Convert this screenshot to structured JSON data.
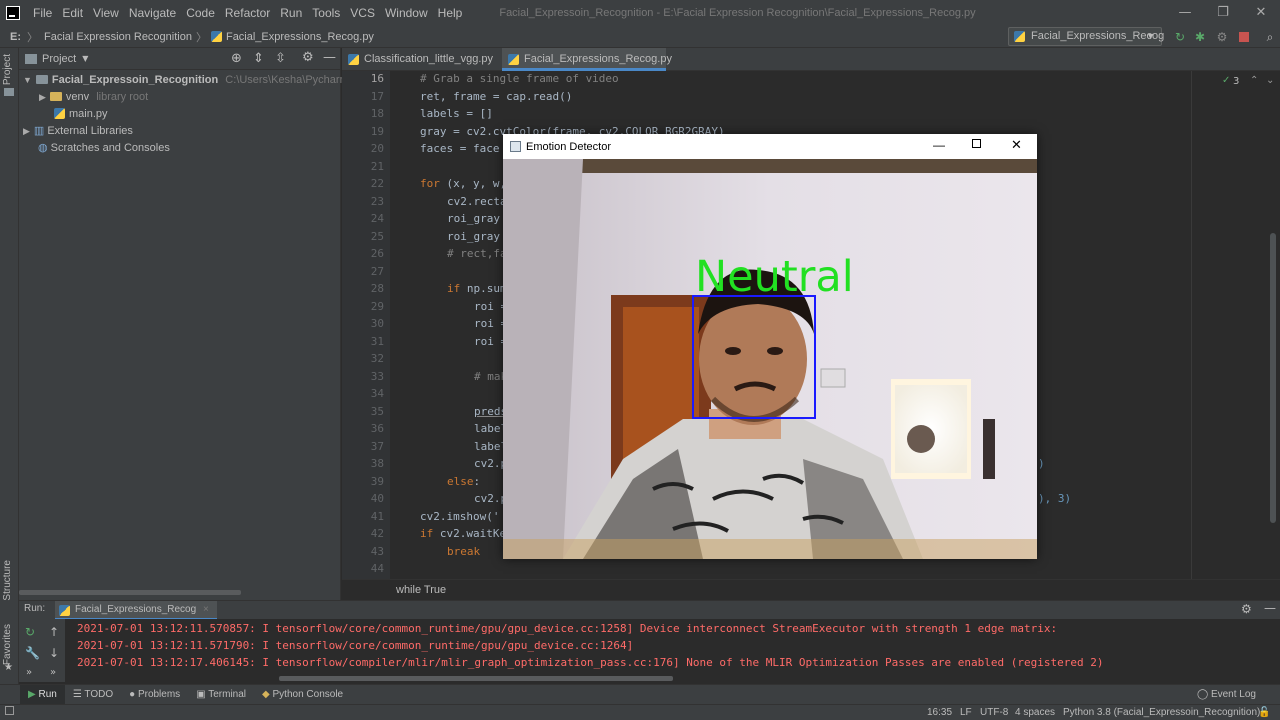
{
  "menubar": {
    "items": [
      "File",
      "Edit",
      "View",
      "Navigate",
      "Code",
      "Refactor",
      "Run",
      "Tools",
      "VCS",
      "Window",
      "Help"
    ],
    "window_title": "Facial_Expressoin_Recognition - E:\\Facial Expression Recognition\\Facial_Expressions_Recog.py"
  },
  "navbar": {
    "drive": "E:",
    "folder": "Facial Expression Recognition",
    "file": "Facial_Expressions_Recog.py",
    "run_config": "Facial_Expressions_Recog"
  },
  "left_stripe": {
    "project_tab": "Project",
    "structure_tab": "Structure",
    "favorites_tab": "Favorites"
  },
  "project_panel": {
    "title": "Project",
    "root_name": "Facial_Expressoin_Recognition",
    "root_path": "C:\\Users\\Kesha\\PycharmProjects",
    "venv_name": "venv",
    "venv_hint": "library root",
    "main_file": "main.py",
    "external_libraries": "External Libraries",
    "scratches": "Scratches and Consoles"
  },
  "editor": {
    "tabs": [
      "Classification_little_vgg.py",
      "Facial_Expressions_Recog.py"
    ],
    "inspection_count": "3",
    "line_numbers": [
      "16",
      "17",
      "18",
      "19",
      "20",
      "21",
      "22",
      "23",
      "24",
      "25",
      "26",
      "27",
      "28",
      "29",
      "30",
      "31",
      "32",
      "33",
      "34",
      "35",
      "36",
      "37",
      "38",
      "39",
      "40",
      "41",
      "42",
      "43",
      "44"
    ],
    "code": {
      "l16": "# Grab a single frame of video",
      "l17": "ret, frame = cap.read()",
      "l18": "labels = []",
      "l19": "gray = cv2.cvtColor(frame, cv2.COLOR_BGR2GRAY)",
      "l20": "faces = face",
      "l22_kw": "for",
      "l22": " (x, y, w,",
      "l23": "cv2.recta",
      "l24": "roi_gray",
      "l25": "roi_gray",
      "l26": "# rect,fa",
      "l28_kw": "if",
      "l28": " np.sum",
      "l29": "roi =",
      "l30": "roi =",
      "l31": "roi =",
      "l33": "# mak",
      "l35": "preds",
      "l36": "label",
      "l37": "label",
      "l38": "cv2.p",
      "l38_tail": ")",
      "l39_kw": "else",
      "l39": ":",
      "l40": "cv2.p",
      "l40_tail": "), 3)",
      "l41": "cv2.imshow('",
      "l42_kw": "if",
      "l42": " cv2.waitKe",
      "l43": "break"
    },
    "breadcrumb": "while True"
  },
  "popup": {
    "title": "Emotion Detector",
    "emotion_label": "Neutral",
    "label_color": "#22e022",
    "box_color": "#1a1aff"
  },
  "run_panel": {
    "label": "Run:",
    "tab": "Facial_Expressions_Recog",
    "lines": [
      "2021-07-01 13:12:11.570857: I tensorflow/core/common_runtime/gpu/gpu_device.cc:1258] Device interconnect StreamExecutor with strength 1 edge matrix:",
      "2021-07-01 13:12:11.571790: I tensorflow/core/common_runtime/gpu/gpu_device.cc:1264]",
      "2021-07-01 13:12:17.406145: I tensorflow/compiler/mlir/mlir_graph_optimization_pass.cc:176] None of the MLIR Optimization Passes are enabled (registered 2)"
    ]
  },
  "bottom_tabs": {
    "run": "Run",
    "todo": "TODO",
    "problems": "Problems",
    "terminal": "Terminal",
    "python_console": "Python Console",
    "event_log": "Event Log"
  },
  "statusbar": {
    "position": "16:35",
    "line_sep": "LF",
    "encoding": "UTF-8",
    "indent": "4 spaces",
    "interpreter": "Python 3.8 (Facial_Expressoin_Recognition)"
  }
}
